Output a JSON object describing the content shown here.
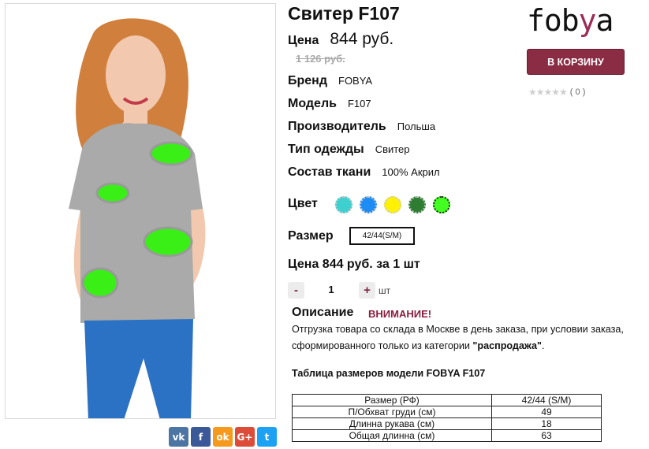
{
  "product": {
    "title": "Свитер F107",
    "price_label": "Цена",
    "price": "844 руб.",
    "old_price": "1 126 руб."
  },
  "attributes": [
    {
      "key": "Бренд",
      "value": "FOBYA"
    },
    {
      "key": "Модель",
      "value": "F107"
    },
    {
      "key": "Производитель",
      "value": "Польша"
    },
    {
      "key": "Тип одежды",
      "value": "Свитер"
    },
    {
      "key": "Состав ткани",
      "value": "100% Акрил"
    }
  ],
  "color_label": "Цвет",
  "colors": [
    "#3ecfcf",
    "#1e8cf5",
    "#fff200",
    "#2e7d32",
    "#44ff22"
  ],
  "size_label": "Размер",
  "size_selected": "42/44(S/M)",
  "unit_price_text": "Цена 844 руб. за 1 шт",
  "quantity": {
    "minus": "-",
    "value": "1",
    "plus": "+",
    "unit": "шт"
  },
  "description": {
    "label": "Описание",
    "warning": "ВНИМАНИЕ!",
    "text_part1": "Отгрузка товара со склада в Москве в день заказа, при условии заказа, сформированного только из категории ",
    "text_bold": "\"распродажа\"",
    "text_part2": "."
  },
  "size_table": {
    "title": "Таблица размеров модели FOBYA F107",
    "rows": [
      [
        "Размер (РФ)",
        "42/44 (S/M)"
      ],
      [
        "П/Обхват груди (см)",
        "49"
      ],
      [
        "Длинна рукава (см)",
        "18"
      ],
      [
        "Общая длинна (см)",
        "63"
      ]
    ]
  },
  "brand_logo": {
    "part1": "fob",
    "part2": "y",
    "part3": "a"
  },
  "cart_button": "В КОРЗИНУ",
  "rating": {
    "stars": "★★★★★",
    "count": "( 0 )"
  },
  "share": [
    {
      "name": "vk-icon",
      "glyph": "vk",
      "color": "#4c75a3"
    },
    {
      "name": "facebook-icon",
      "glyph": "f",
      "color": "#3b5998"
    },
    {
      "name": "odnoklassniki-icon",
      "glyph": "ok",
      "color": "#f59a1d"
    },
    {
      "name": "google-plus-icon",
      "glyph": "G+",
      "color": "#dd4b39"
    },
    {
      "name": "twitter-icon",
      "glyph": "t",
      "color": "#1da1f2"
    }
  ]
}
